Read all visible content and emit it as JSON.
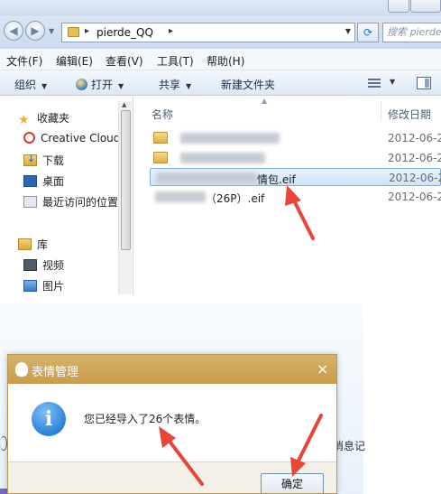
{
  "explorer": {
    "breadcrumb": {
      "sep1": "▸",
      "folder": "pierde_QQ",
      "sep2": "▸"
    },
    "search_placeholder": "搜索 pierde_QQ",
    "nav_back": "◀",
    "nav_forward": "▶",
    "refresh": "⟳",
    "menu": [
      "文件(F)",
      "编辑(E)",
      "查看(V)",
      "工具(T)",
      "帮助(H)"
    ],
    "toolbar": {
      "organize": "组织",
      "open": "打开",
      "share": "共享",
      "new_folder": "新建文件夹",
      "arrow": "▼"
    },
    "nav_pane": {
      "favorites": "收藏夹",
      "items": [
        "Creative Cloud",
        "下载",
        "桌面",
        "最近访问的位置"
      ],
      "library": "库",
      "library_items": [
        "视频",
        "图片"
      ]
    },
    "columns": {
      "name": "名称",
      "modified": "修改日期"
    },
    "files": [
      {
        "name": "",
        "date": "2012-06-2"
      },
      {
        "name": "",
        "date": "2012-06-2"
      },
      {
        "name": "情包.eif",
        "date": "2012-06-2",
        "selected": true
      },
      {
        "name": "（26P）.eif",
        "date": "2012-06-2"
      }
    ]
  },
  "dialog": {
    "title": "表情管理",
    "close": "×",
    "info_glyph": "i",
    "message": "您已经导入了26个表情。",
    "ok_label": "确定"
  },
  "background": {
    "partial_text": "消息记"
  },
  "colors": {
    "arrow": "#e8463b",
    "dialog_title": "#c89d4d",
    "selection_border": "#84acdd"
  }
}
